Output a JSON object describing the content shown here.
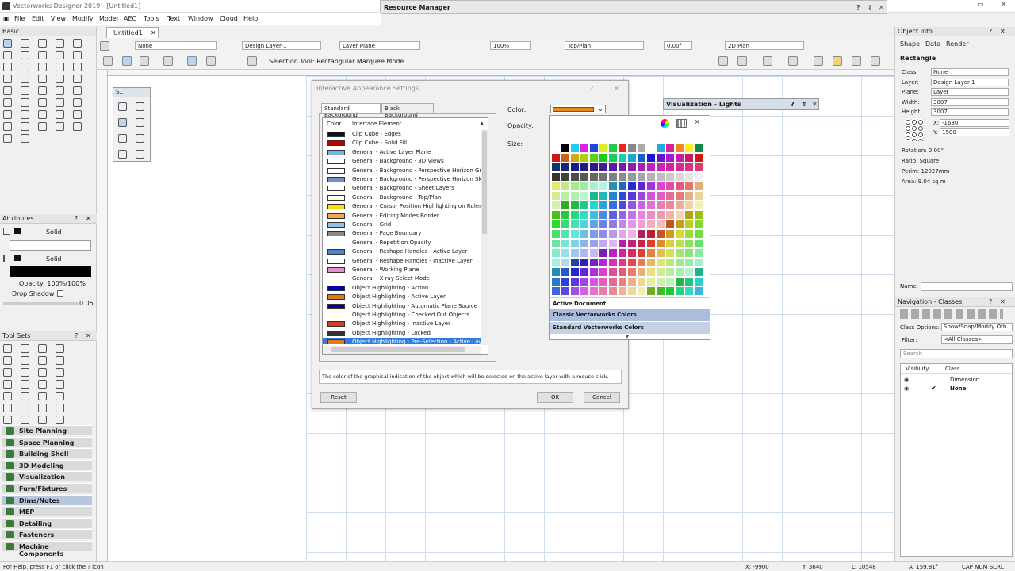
{
  "app": {
    "title": "Vectorworks Designer 2019 - [Untitled1]",
    "menus": [
      "File",
      "Edit",
      "View",
      "Modify",
      "Model",
      "AEC",
      "Tools",
      "Text",
      "Window",
      "Cloud",
      "Help"
    ],
    "doc_tab": "Untitled1"
  },
  "resource_manager": {
    "title": "Resource Manager"
  },
  "toolbar": {
    "class_select": "None",
    "layer_select": "Design Layer-1",
    "plane_select": "Layer Plane",
    "zoom": "100%",
    "view_select": "Top/Plan",
    "angle": "0.00°",
    "render_select": "2D Plan",
    "mode_text": "Selection Tool: Rectangular Marquee Mode"
  },
  "left": {
    "basic_title": "Basic",
    "snapping_title": "S...",
    "attributes_title": "Attributes",
    "fill_style": "Solid",
    "pen_style": "Solid",
    "opacity": "Opacity: 100%/100%",
    "drop_shadow": "Drop Shadow",
    "line_weight": "0.05",
    "toolsets_title": "Tool Sets",
    "workspaces": [
      "Site Planning",
      "Space Planning",
      "Building Shell",
      "3D Modeling",
      "Visualization",
      "Furn/Fixtures",
      "Dims/Notes",
      "MEP",
      "Detailing",
      "Fasteners",
      "Machine Components"
    ]
  },
  "dialog": {
    "title": "Interactive Appearance Settings",
    "tabs": [
      "Standard Background",
      "Black Background"
    ],
    "col_color": "Color",
    "col_element": "Interface Element",
    "items": [
      {
        "label": "Clip Cube - Edges",
        "color": "#111111"
      },
      {
        "label": "Clip Cube - Solid Fill",
        "color": "#c00000"
      },
      {
        "label": "General - Active Layer Plane",
        "color": "#7fb2e0"
      },
      {
        "label": "General - Background - 3D Views",
        "color": "#ffffff"
      },
      {
        "label": "General - Background - Perspective Horizon Groun",
        "color": "#ffffff"
      },
      {
        "label": "General - Background - Perspective Horizon Sky",
        "color": "#6f8fc8"
      },
      {
        "label": "General - Background - Sheet Layers",
        "color": "#ffffff"
      },
      {
        "label": "General - Background - Top/Plan",
        "color": "#ffffff"
      },
      {
        "label": "General - Cursor Position Highlighting on Ruler",
        "color": "#f5e400"
      },
      {
        "label": "General - Editing Modes Border",
        "color": "#f2a65a"
      },
      {
        "label": "General - Grid",
        "color": "#8fc0e8"
      },
      {
        "label": "General - Page Boundary",
        "color": "#888888"
      },
      {
        "label": "General - Repetition Opacity",
        "color": ""
      },
      {
        "label": "General - Reshape Handles - Active Layer",
        "color": "#4a86d0"
      },
      {
        "label": "General - Reshape Handles - Inactive Layer",
        "color": "#ffffff"
      },
      {
        "label": "General - Working Plane",
        "color": "#e68fcf"
      },
      {
        "label": "General - X-ray Select Mode",
        "color": ""
      },
      {
        "label": "Object Highlighting - Action",
        "color": "#0000b0"
      },
      {
        "label": "Object Highlighting - Active Layer",
        "color": "#e07820"
      },
      {
        "label": "Object Highlighting - Automatic Plane Source",
        "color": "#0000b0"
      },
      {
        "label": "Object Highlighting - Checked Out Objects",
        "color": ""
      },
      {
        "label": "Object Highlighting - Inactive Layer",
        "color": "#d04020"
      },
      {
        "label": "Object Highlighting - Locked",
        "color": "#333333"
      },
      {
        "label": "Object Highlighting - Pre-Selection - Active Layer",
        "color": "#e07820"
      }
    ],
    "color_label": "Color:",
    "opacity_label": "Opacity:",
    "size_label": "Size:",
    "current_color": "#e88a1a",
    "description": "The color of the graphical indication of the object which will be selected on the active layer with a mouse click.",
    "reset": "Reset",
    "ok": "OK",
    "cancel": "Cancel"
  },
  "palette": {
    "sections": [
      "Active Document",
      "Classic Vectorworks Colors",
      "Standard Vectorworks Colors"
    ]
  },
  "viz_panel": {
    "title": "Visualization - Lights"
  },
  "object_info": {
    "title": "Object Info",
    "tabs": [
      "Shape",
      "Data",
      "Render"
    ],
    "object_type": "Rectangle",
    "rows": [
      {
        "k": "Class:",
        "v": "None"
      },
      {
        "k": "Layer:",
        "v": "Design Layer-1"
      },
      {
        "k": "Plane:",
        "v": "Layer"
      },
      {
        "k": "Width:",
        "v": "3007"
      },
      {
        "k": "Height:",
        "v": "3007"
      }
    ],
    "x_label": "X:",
    "x_val": "-1680",
    "y_label": "Y:",
    "y_val": "1500",
    "rotation": "Rotation:  0.00°",
    "ratio": "Ratio:        Square",
    "perim": "Perim:        12027mm",
    "area": "Area:         9.04 sq m",
    "name_label": "Name:"
  },
  "navigation": {
    "title": "Navigation - Classes",
    "class_options_label": "Class Options:",
    "class_options_val": "Show/Snap/Modify Oth",
    "filter_label": "Filter:",
    "filter_val": "<All Classes>",
    "search_placeholder": "Search",
    "col_visibility": "Visibility",
    "col_class": "Class",
    "rows": [
      "Dimension",
      "None"
    ]
  },
  "status": {
    "help": "For Help, press F1 or click the ? icon",
    "x": "X: -9900",
    "y": "Y: 3640",
    "l": "L: 10548",
    "a": "A: 159.81°",
    "caps": "CAP NUM SCRL"
  }
}
